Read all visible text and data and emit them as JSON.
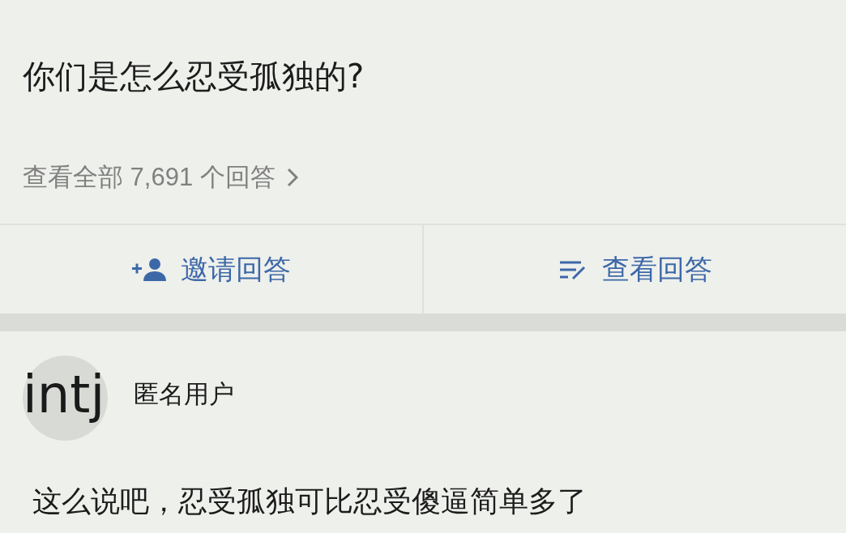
{
  "question": {
    "title": "你们是怎么忍受孤独的?",
    "answers_link": "查看全部 7,691 个回答"
  },
  "actions": [
    {
      "kind": "invite",
      "label": "邀请回答"
    },
    {
      "kind": "view",
      "label": "查看回答"
    }
  ],
  "answer": {
    "overlay_text": "intj",
    "author": "匿名用户",
    "text": "这么说吧，忍受孤独可比忍受傻逼简单多了"
  }
}
